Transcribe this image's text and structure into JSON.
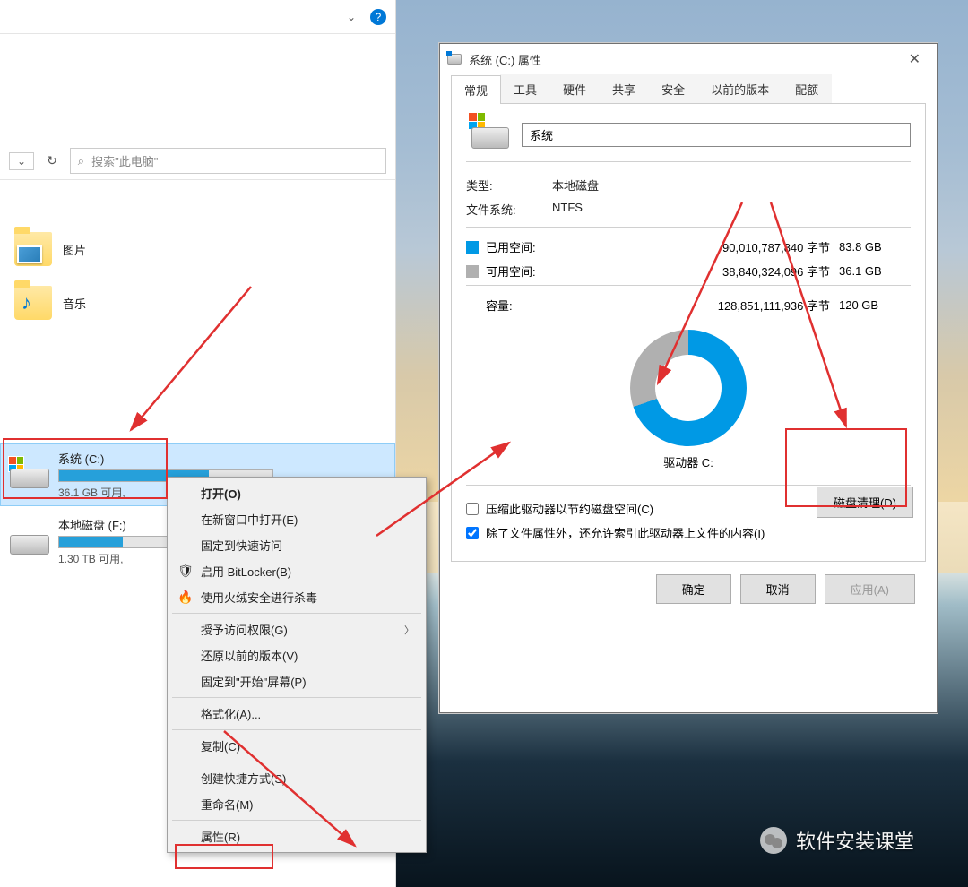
{
  "explorer": {
    "search_placeholder": "搜索\"此电脑\"",
    "folders": [
      {
        "label": "图片",
        "type": "pictures"
      },
      {
        "label": "音乐",
        "type": "music"
      }
    ],
    "drives": [
      {
        "name": "系统 (C:)",
        "free_text": "36.1 GB 可用,",
        "fill_pct": 70,
        "selected": true,
        "has_win_logo": true
      },
      {
        "name": "本地磁盘 (F:)",
        "free_text": "1.30 TB 可用,",
        "fill_pct": 30,
        "selected": false,
        "has_win_logo": false
      }
    ]
  },
  "context_menu": {
    "items": [
      {
        "label": "打开(O)",
        "bold": true
      },
      {
        "label": "在新窗口中打开(E)"
      },
      {
        "label": "固定到快速访问"
      },
      {
        "label": "启用 BitLocker(B)",
        "icon": "shield"
      },
      {
        "label": "使用火绒安全进行杀毒",
        "icon": "flame"
      },
      {
        "sep": true
      },
      {
        "label": "授予访问权限(G)",
        "submenu": true
      },
      {
        "label": "还原以前的版本(V)"
      },
      {
        "label": "固定到\"开始\"屏幕(P)"
      },
      {
        "sep": true
      },
      {
        "label": "格式化(A)..."
      },
      {
        "sep": true
      },
      {
        "label": "复制(C)"
      },
      {
        "sep": true
      },
      {
        "label": "创建快捷方式(S)"
      },
      {
        "label": "重命名(M)"
      },
      {
        "sep": true
      },
      {
        "label": "属性(R)"
      }
    ]
  },
  "properties": {
    "title": "系统 (C:) 属性",
    "tabs": [
      "常规",
      "工具",
      "硬件",
      "共享",
      "安全",
      "以前的版本",
      "配额"
    ],
    "active_tab": 0,
    "name_value": "系统",
    "type_label": "类型:",
    "type_value": "本地磁盘",
    "fs_label": "文件系统:",
    "fs_value": "NTFS",
    "used_label": "已用空间:",
    "used_bytes": "90,010,787,840 字节",
    "used_h": "83.8 GB",
    "free_label": "可用空间:",
    "free_bytes": "38,840,324,096 字节",
    "free_h": "36.1 GB",
    "cap_label": "容量:",
    "cap_bytes": "128,851,111,936 字节",
    "cap_h": "120 GB",
    "drive_label": "驱动器 C:",
    "cleanup_label": "磁盘清理(D)",
    "compress_label": "压缩此驱动器以节约磁盘空间(C)",
    "index_label": "除了文件属性外，还允许索引此驱动器上文件的内容(I)",
    "ok": "确定",
    "cancel": "取消",
    "apply": "应用(A)"
  },
  "watermark": "软件安装课堂"
}
